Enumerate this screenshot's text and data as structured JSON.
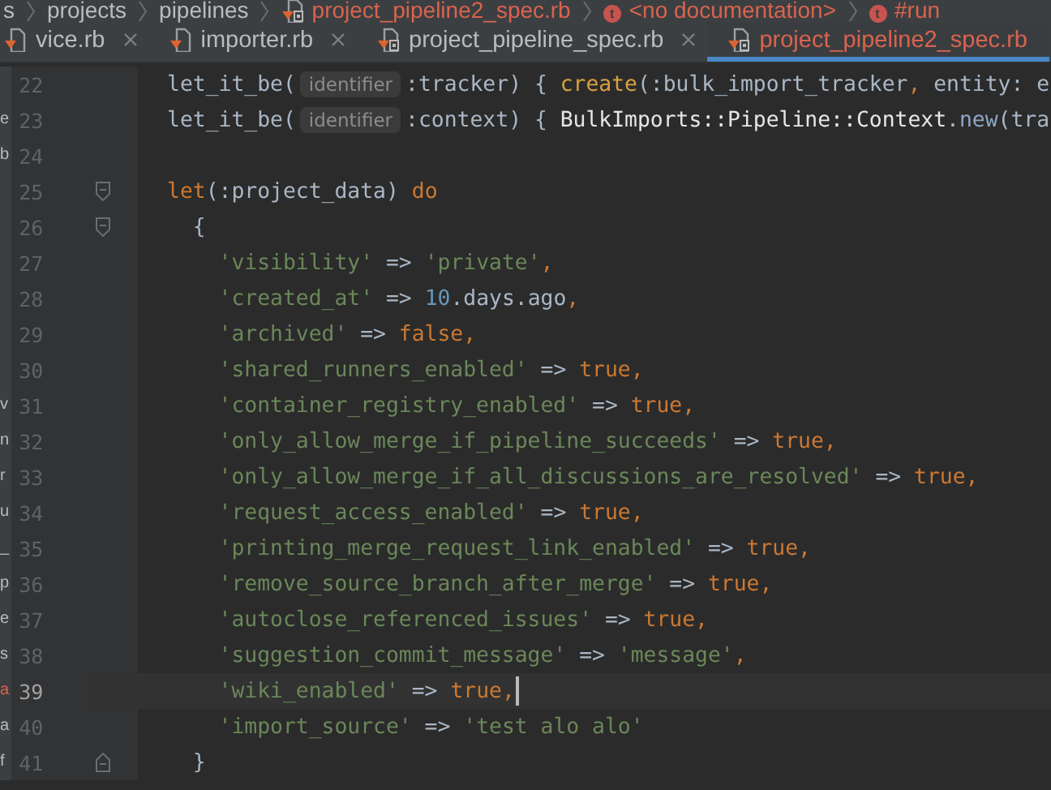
{
  "breadcrumb": [
    {
      "text": "s",
      "kind": "folder",
      "error": false
    },
    {
      "text": "projects",
      "kind": "folder",
      "error": false
    },
    {
      "text": "pipelines",
      "kind": "folder",
      "error": false
    },
    {
      "text": "project_pipeline2_spec.rb",
      "kind": "file",
      "error": true
    },
    {
      "text": "<no documentation>",
      "kind": "member",
      "badge": "t",
      "error": true
    },
    {
      "text": "#run",
      "kind": "member",
      "badge": "t",
      "error": true
    }
  ],
  "tabs": [
    {
      "label": "vice.rb",
      "selected": false,
      "kind": "source"
    },
    {
      "label": "importer.rb",
      "selected": false,
      "kind": "source"
    },
    {
      "label": "project_pipeline_spec.rb",
      "selected": false,
      "kind": "spec"
    },
    {
      "label": "project_pipeline2_spec.rb",
      "selected": true,
      "kind": "spec"
    }
  ],
  "editor": {
    "lines": [
      {
        "number": "22",
        "current": false,
        "kind": "code",
        "tokens": [
          {
            "kind": "plain",
            "text": "let_it_be("
          },
          {
            "kind": "hint",
            "text": "identifier"
          },
          {
            "kind": "symbol",
            "text": ":tracker"
          },
          {
            "kind": "plain",
            "text": ") { "
          },
          {
            "kind": "method",
            "text": "create"
          },
          {
            "kind": "plain",
            "text": "(:bulk_import_tracker"
          },
          {
            "kind": "keyword",
            "text": ","
          },
          {
            "kind": "plain",
            "text": " entity: e"
          }
        ]
      },
      {
        "number": "23",
        "current": false,
        "kind": "code",
        "side": {
          "text": "e",
          "flagged": false
        },
        "tokens": [
          {
            "kind": "plain",
            "text": "let_it_be("
          },
          {
            "kind": "hint",
            "text": "identifier"
          },
          {
            "kind": "symbol",
            "text": ":context"
          },
          {
            "kind": "plain",
            "text": ") { "
          },
          {
            "kind": "constant",
            "text": "BulkImports::Pipeline::Context"
          },
          {
            "kind": "plain",
            "text": "."
          },
          {
            "kind": "call",
            "text": "new"
          },
          {
            "kind": "plain",
            "text": "(tra"
          }
        ]
      },
      {
        "number": "24",
        "current": false,
        "kind": "code",
        "side": {
          "text": "b",
          "flagged": false
        }
      },
      {
        "number": "25",
        "current": false,
        "kind": "fold_start",
        "tokens": [
          {
            "kind": "keyword",
            "text": "let"
          },
          {
            "kind": "plain",
            "text": "(:project_data) "
          },
          {
            "kind": "keyword",
            "text": "do"
          }
        ]
      },
      {
        "number": "26",
        "current": false,
        "kind": "fold_start",
        "tokens": [
          {
            "kind": "plain",
            "text": "  {"
          }
        ]
      },
      {
        "number": "27",
        "current": false,
        "kind": "code",
        "tokens": [
          {
            "kind": "string",
            "text": "    'visibility'"
          },
          {
            "kind": "plain",
            "text": " => "
          },
          {
            "kind": "string",
            "text": "'private'"
          },
          {
            "kind": "keyword",
            "text": ","
          }
        ]
      },
      {
        "number": "28",
        "current": false,
        "kind": "code",
        "tokens": [
          {
            "kind": "string",
            "text": "    'created_at'"
          },
          {
            "kind": "plain",
            "text": " => "
          },
          {
            "kind": "number",
            "text": "10"
          },
          {
            "kind": "plain",
            "text": ".days.ago"
          },
          {
            "kind": "keyword",
            "text": ","
          }
        ]
      },
      {
        "number": "29",
        "current": false,
        "kind": "code",
        "tokens": [
          {
            "kind": "string",
            "text": "    'archived'"
          },
          {
            "kind": "plain",
            "text": " => "
          },
          {
            "kind": "keyword",
            "text": "false,"
          }
        ]
      },
      {
        "number": "30",
        "current": false,
        "kind": "code",
        "tokens": [
          {
            "kind": "string",
            "text": "    'shared_runners_enabled'"
          },
          {
            "kind": "plain",
            "text": " => "
          },
          {
            "kind": "keyword",
            "text": "true,"
          }
        ]
      },
      {
        "number": "31",
        "current": false,
        "kind": "code",
        "side": {
          "text": "v",
          "flagged": false
        },
        "tokens": [
          {
            "kind": "string",
            "text": "    'container_registry_enabled'"
          },
          {
            "kind": "plain",
            "text": " => "
          },
          {
            "kind": "keyword",
            "text": "true,"
          }
        ]
      },
      {
        "number": "32",
        "current": false,
        "kind": "code",
        "side": {
          "text": "n",
          "flagged": false
        },
        "tokens": [
          {
            "kind": "string",
            "text": "    'only_allow_merge_if_pipeline_succeeds'"
          },
          {
            "kind": "plain",
            "text": " => "
          },
          {
            "kind": "keyword",
            "text": "true,"
          }
        ]
      },
      {
        "number": "33",
        "current": false,
        "kind": "code",
        "side": {
          "text": "r",
          "flagged": false
        },
        "tokens": [
          {
            "kind": "string",
            "text": "    'only_allow_merge_if_all_discussions_are_resolved'"
          },
          {
            "kind": "plain",
            "text": " => "
          },
          {
            "kind": "keyword",
            "text": "true,"
          }
        ]
      },
      {
        "number": "34",
        "current": false,
        "kind": "code",
        "side": {
          "text": "u",
          "flagged": false
        },
        "tokens": [
          {
            "kind": "string",
            "text": "    'request_access_enabled'"
          },
          {
            "kind": "plain",
            "text": " => "
          },
          {
            "kind": "keyword",
            "text": "true,"
          }
        ]
      },
      {
        "number": "35",
        "current": false,
        "kind": "code",
        "side": {
          "text": "_",
          "flagged": false
        },
        "tokens": [
          {
            "kind": "string",
            "text": "    'printing_merge_request_link_enabled'"
          },
          {
            "kind": "plain",
            "text": " => "
          },
          {
            "kind": "keyword",
            "text": "true,"
          }
        ]
      },
      {
        "number": "36",
        "current": false,
        "kind": "code",
        "side": {
          "text": "p",
          "flagged": false
        },
        "tokens": [
          {
            "kind": "string",
            "text": "    'remove_source_branch_after_merge'"
          },
          {
            "kind": "plain",
            "text": " => "
          },
          {
            "kind": "keyword",
            "text": "true,"
          }
        ]
      },
      {
        "number": "37",
        "current": false,
        "kind": "code",
        "side": {
          "text": "e",
          "flagged": false
        },
        "tokens": [
          {
            "kind": "string",
            "text": "    'autoclose_referenced_issues'"
          },
          {
            "kind": "plain",
            "text": " => "
          },
          {
            "kind": "keyword",
            "text": "true,"
          }
        ]
      },
      {
        "number": "38",
        "current": false,
        "kind": "code",
        "side": {
          "text": "s",
          "flagged": false
        },
        "tokens": [
          {
            "kind": "string",
            "text": "    'suggestion_commit_message'"
          },
          {
            "kind": "plain",
            "text": " => "
          },
          {
            "kind": "string",
            "text": "'message'"
          },
          {
            "kind": "keyword",
            "text": ","
          }
        ]
      },
      {
        "number": "39",
        "current": true,
        "kind": "code",
        "side": {
          "text": "a",
          "flagged": true
        },
        "tokens": [
          {
            "kind": "string",
            "text": "    'wiki_enabled'"
          },
          {
            "kind": "plain",
            "text": " => "
          },
          {
            "kind": "keyword",
            "text": "true,"
          }
        ]
      },
      {
        "number": "40",
        "current": false,
        "kind": "code",
        "side": {
          "text": "a",
          "flagged": false
        },
        "tokens": [
          {
            "kind": "string",
            "text": "    'import_source'"
          },
          {
            "kind": "plain",
            "text": " => "
          },
          {
            "kind": "string",
            "text": "'test alo alo'"
          }
        ]
      },
      {
        "number": "41",
        "current": false,
        "kind": "fold_end",
        "side": {
          "text": "f",
          "flagged": false
        },
        "tokens": [
          {
            "kind": "plain",
            "text": "  }"
          }
        ]
      }
    ]
  }
}
